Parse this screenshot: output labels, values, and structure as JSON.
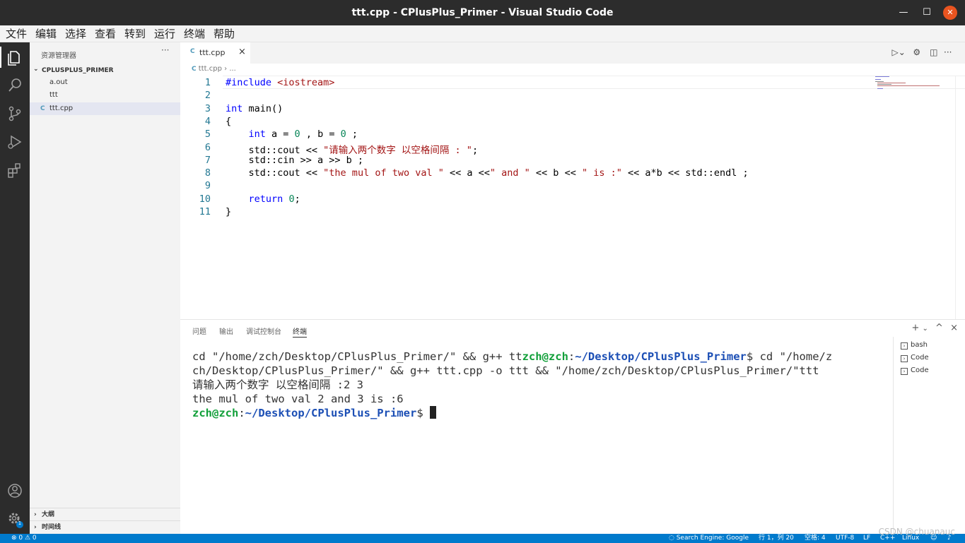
{
  "window": {
    "title": "ttt.cpp - CPlusPlus_Primer - Visual Studio Code"
  },
  "menu": [
    "文件",
    "编辑",
    "选择",
    "查看",
    "转到",
    "运行",
    "终端",
    "帮助"
  ],
  "activity_bar": {
    "items": [
      "explorer-icon",
      "search-icon",
      "source-control-icon",
      "run-debug-icon",
      "extensions-icon"
    ],
    "bottom": [
      "account-icon",
      "settings-gear-icon"
    ],
    "settings_badge": "1"
  },
  "sidebar": {
    "header": "资源管理器",
    "more": "···",
    "project": "CPLUSPLUS_PRIMER",
    "files": [
      {
        "name": "a.out",
        "icon": "file-icon",
        "selected": false
      },
      {
        "name": "ttt",
        "icon": "file-icon",
        "selected": false
      },
      {
        "name": "ttt.cpp",
        "icon": "cpp-file-icon",
        "selected": true
      }
    ],
    "outline": "大纲",
    "timeline": "时间线"
  },
  "editor": {
    "tab": {
      "label": "ttt.cpp",
      "close": "×"
    },
    "breadcrumb": {
      "file": "ttt.cpp",
      "sep": "›",
      "rest": "..."
    },
    "lines": [
      {
        "n": "1",
        "segs": [
          [
            "pp",
            "#include "
          ],
          [
            "str",
            "<iostream>"
          ]
        ]
      },
      {
        "n": "2",
        "segs": []
      },
      {
        "n": "3",
        "segs": [
          [
            "kw",
            "int"
          ],
          [
            "t",
            " main()"
          ]
        ]
      },
      {
        "n": "4",
        "segs": [
          [
            "t",
            "{"
          ]
        ]
      },
      {
        "n": "5",
        "segs": [
          [
            "t",
            "    "
          ],
          [
            "kw",
            "int"
          ],
          [
            "t",
            " a = "
          ],
          [
            "num",
            "0"
          ],
          [
            "t",
            " , b = "
          ],
          [
            "num",
            "0"
          ],
          [
            "t",
            " ;"
          ]
        ]
      },
      {
        "n": "6",
        "segs": [
          [
            "t",
            "    std::cout << "
          ],
          [
            "str",
            "\"请输入两个数字 以空格间隔 : \""
          ],
          [
            "t",
            ";"
          ]
        ]
      },
      {
        "n": "7",
        "segs": [
          [
            "t",
            "    std::cin >> a >> b ;"
          ]
        ]
      },
      {
        "n": "8",
        "segs": [
          [
            "t",
            "    std::cout << "
          ],
          [
            "str",
            "\"the mul of two val \""
          ],
          [
            "t",
            " << a <<"
          ],
          [
            "str",
            "\" and \""
          ],
          [
            "t",
            " << b << "
          ],
          [
            "str",
            "\" is :\""
          ],
          [
            "t",
            " << a*b << std::endl ;"
          ]
        ]
      },
      {
        "n": "9",
        "segs": []
      },
      {
        "n": "10",
        "segs": [
          [
            "t",
            "    "
          ],
          [
            "kw",
            "return"
          ],
          [
            "t",
            " "
          ],
          [
            "num",
            "0"
          ],
          [
            "t",
            ";"
          ]
        ]
      },
      {
        "n": "11",
        "segs": [
          [
            "t",
            "}"
          ]
        ]
      }
    ]
  },
  "panel": {
    "tabs": [
      "问题",
      "输出",
      "调试控制台",
      "终端"
    ],
    "active_tab": "终端",
    "actions": {
      "add": "+",
      "dropdown": "⌄",
      "maximize": "^",
      "close": "×"
    },
    "terminal_lines": [
      [
        [
          "t",
          "cd \"/home/zch/Desktop/CPlusPlus_Primer/\" && g++ tt"
        ],
        [
          "u",
          "zch@zch"
        ],
        [
          "t",
          ":"
        ],
        [
          "p",
          "~/Desktop/CPlusPlus_Primer"
        ],
        [
          "t",
          "$ cd \"/home/z"
        ]
      ],
      [
        [
          "t",
          "ch/Desktop/CPlusPlus_Primer/\" && g++ ttt.cpp -o ttt && \"/home/zch/Desktop/CPlusPlus_Primer/\"ttt"
        ]
      ],
      [
        [
          "t",
          "请输入两个数字 以空格间隔 :2 3"
        ]
      ],
      [
        [
          "t",
          "the mul of two val 2 and 3 is :6"
        ]
      ],
      [
        [
          "u",
          "zch@zch"
        ],
        [
          "t",
          ":"
        ],
        [
          "p",
          "~/Desktop/CPlusPlus_Primer"
        ],
        [
          "t",
          "$ "
        ],
        [
          "cursor",
          ""
        ]
      ]
    ],
    "terminals": [
      "bash",
      "Code",
      "Code"
    ]
  },
  "status_bar": {
    "problems": "⊗ 0 ⚠ 0",
    "search_engine": "Search Engine: Google",
    "position": "行 1，列 20",
    "spaces": "空格: 4",
    "encoding": "UTF-8",
    "eol": "LF",
    "language": "C++",
    "os": "Linux"
  },
  "watermark": "CSDN @chuanauc"
}
